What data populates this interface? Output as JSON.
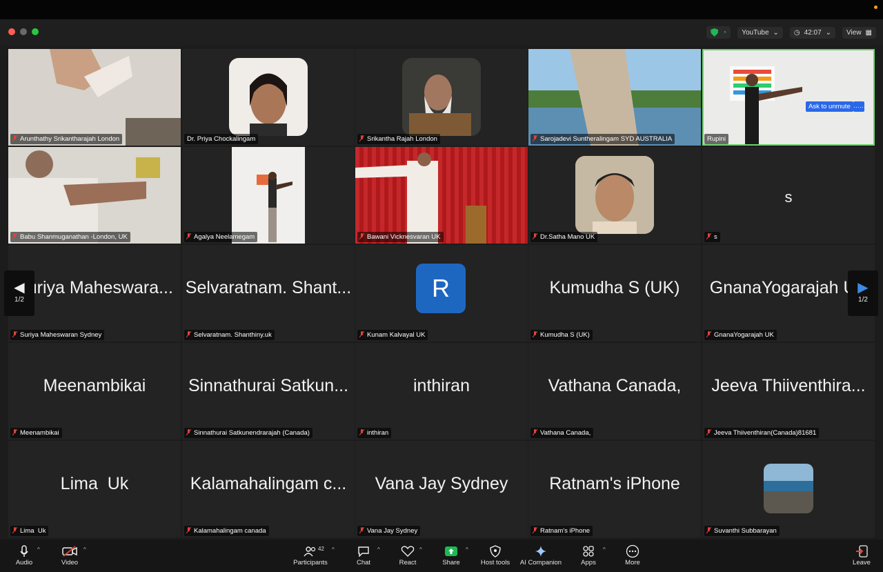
{
  "window": {
    "youtube_label": "YouTube",
    "timer": "42:07",
    "view_label": "View"
  },
  "tiles": [
    {
      "name": "Arunthathy Srikantharajah London"
    },
    {
      "name": "Dr. Priya Chockalingam"
    },
    {
      "name": "Srikantha Rajah London"
    },
    {
      "name": "Sarojadevi Suntheralingam SYD AUSTRALIA"
    },
    {
      "name": "Rupini"
    },
    {
      "name": "Babu Shanmuganathan -London, UK"
    },
    {
      "name": "Agalya Neelamegam"
    },
    {
      "name": "Bawani Vicknesvaran UK"
    },
    {
      "name": "Dr.Satha Mano UK"
    },
    {
      "name": "s",
      "big": "s"
    },
    {
      "name": "Suriya Maheswaran Sydney",
      "big": "Suriya Maheswara..."
    },
    {
      "name": "Selvaratnam. Shanthiny.uk",
      "big": "Selvaratnam. Shant..."
    },
    {
      "name": "Kunam Kalvayal UK",
      "avatar": "R"
    },
    {
      "name": "Kumudha S (UK)",
      "big": "Kumudha S (UK)"
    },
    {
      "name": "GnanaYogarajah UK",
      "big": "GnanaYogarajah UK"
    },
    {
      "name": "Meenambikai",
      "big": "Meenambikai"
    },
    {
      "name": "Sinnathurai Satkunendrarajah (Canada)",
      "big": "Sinnathurai Satkun..."
    },
    {
      "name": "inthiran",
      "big": "inthiran"
    },
    {
      "name": "Vathana Canada,",
      "big": "Vathana Canada,"
    },
    {
      "name": "Jeeva Thiiventhiran(Canada)81681",
      "big": "Jeeva Thiiventhira..."
    },
    {
      "name": "Lima  Uk",
      "big": "Lima  Uk"
    },
    {
      "name": "Kalamahalingam canada",
      "big": "Kalamahalingam c..."
    },
    {
      "name": "Vana Jay Sydney",
      "big": "Vana Jay Sydney"
    },
    {
      "name": "Ratnam's iPhone",
      "big": "Ratnam's iPhone"
    },
    {
      "name": "Suvanthi Subbarayan"
    }
  ],
  "overlay": {
    "ask_to_unmute": "Ask to unmute",
    "more": "……"
  },
  "pager": {
    "left": "1/2",
    "right": "1/2"
  },
  "toolbar": {
    "audio": "Audio",
    "video": "Video",
    "participants": "Participants",
    "participants_count": "42",
    "chat": "Chat",
    "react": "React",
    "share": "Share",
    "host_tools": "Host tools",
    "ai_companion": "AI Companion",
    "apps": "Apps",
    "more": "More",
    "leave": "Leave"
  },
  "colors": {
    "accent_blue": "#2a68e8",
    "share_green": "#1db954",
    "active_speaker": "#6bd36b",
    "leave_red": "#e0453a"
  }
}
